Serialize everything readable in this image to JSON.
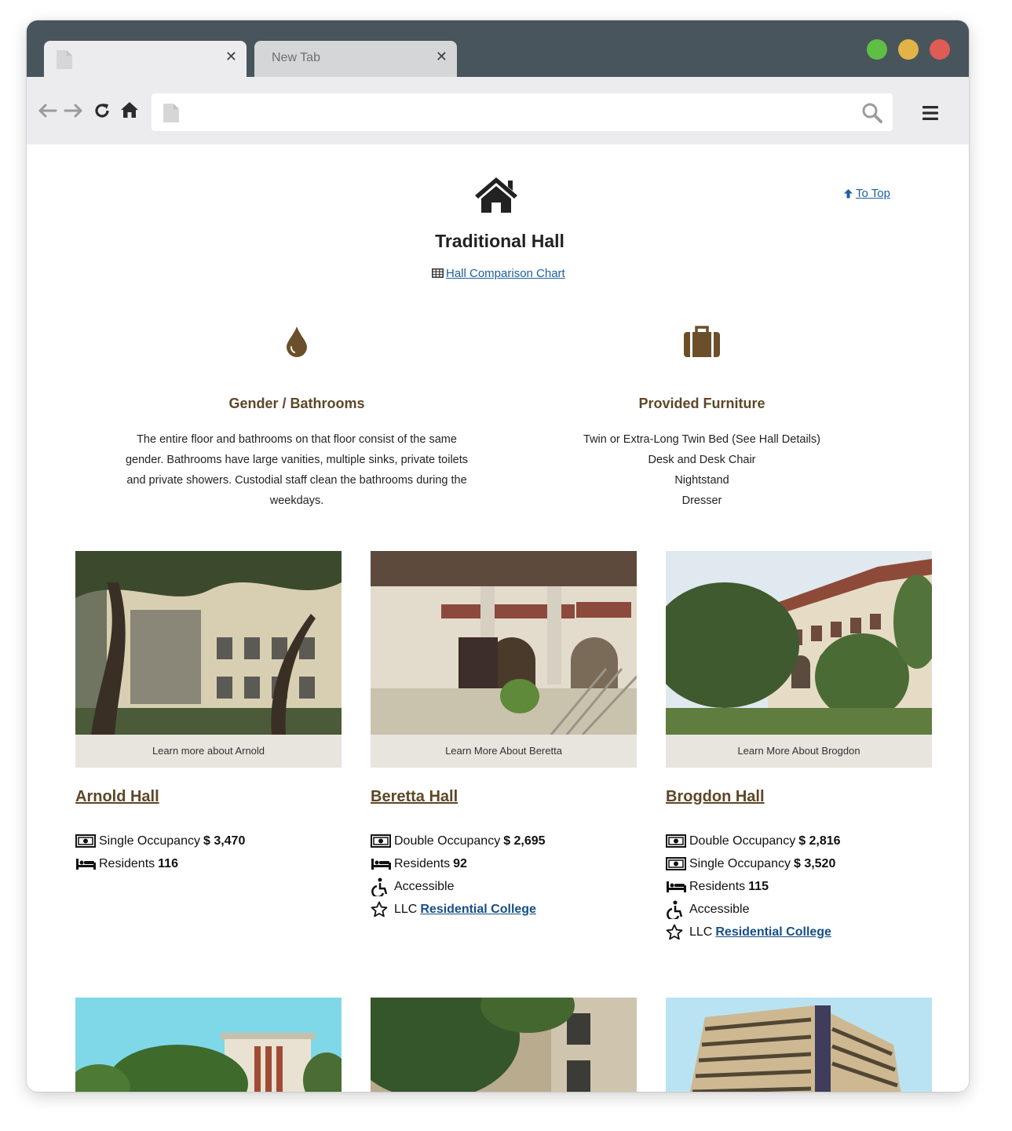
{
  "browser": {
    "tabs": [
      {
        "title": "",
        "close": "✕"
      },
      {
        "title": "New Tab",
        "close": "✕"
      }
    ],
    "url": ""
  },
  "page": {
    "to_top": "To Top",
    "title": "Traditional Hall",
    "comparison_link": "Hall Comparison Chart",
    "features": [
      {
        "icon": "water-drop-icon",
        "heading": "Gender / Bathrooms",
        "lines": [
          "The entire floor and bathrooms on that floor consist of the same",
          "gender. Bathrooms have large vanities, multiple sinks, private toilets",
          "and private showers. Custodial staff clean the bathrooms during the",
          "weekdays."
        ]
      },
      {
        "icon": "suitcase-icon",
        "heading": "Provided Furniture",
        "lines": [
          "Twin or Extra-Long Twin Bed (See Hall Details)",
          "Desk and Desk Chair",
          "Nightstand",
          "Dresser"
        ]
      }
    ],
    "halls": [
      {
        "caption": "Learn more about Arnold",
        "name": "Arnold Hall",
        "occupancy": [
          {
            "label": "Single Occupancy",
            "price": "$ 3,470"
          }
        ],
        "residents_label": "Residents",
        "residents": "116"
      },
      {
        "caption": "Learn More About Beretta",
        "name": "Beretta Hall",
        "occupancy": [
          {
            "label": "Double Occupancy",
            "price": "$ 2,695"
          }
        ],
        "residents_label": "Residents",
        "residents": "92",
        "accessible": "Accessible",
        "llc_label": "LLC",
        "llc_link": "Residential College"
      },
      {
        "caption": "Learn More About Brogdon",
        "name": "Brogdon Hall",
        "occupancy": [
          {
            "label": "Double Occupancy",
            "price": "$ 2,816"
          },
          {
            "label": "Single Occupancy",
            "price": "$ 3,520"
          }
        ],
        "residents_label": "Residents",
        "residents": "115",
        "accessible": "Accessible",
        "llc_label": "LLC",
        "llc_link": "Residential College"
      }
    ]
  },
  "colors": {
    "titlebar": "#48555d",
    "accent_brown": "#5d4726",
    "link_blue": "#1d5fa0",
    "caption_bg": "#e8e4de"
  }
}
